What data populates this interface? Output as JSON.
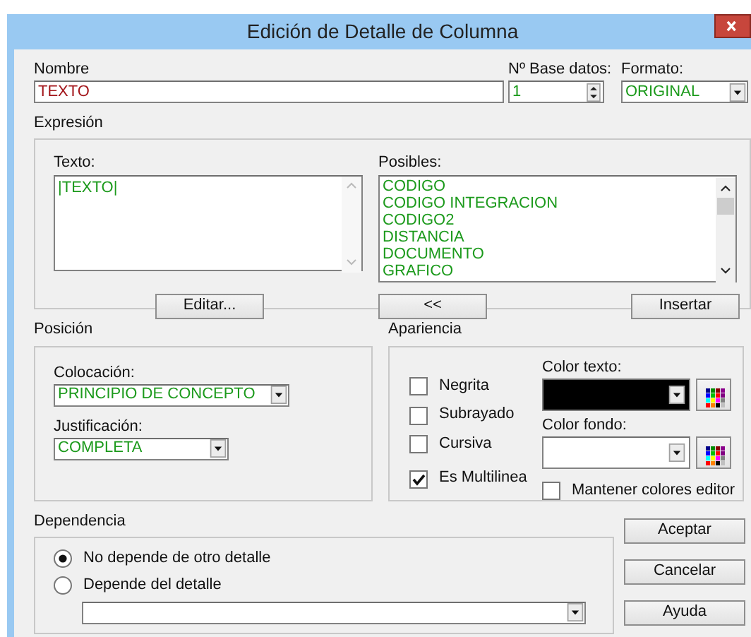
{
  "window": {
    "title": "Edición de Detalle de Columna"
  },
  "nombre": {
    "label": "Nombre",
    "value": "TEXTO"
  },
  "base_datos": {
    "label": "Nº Base datos:",
    "value": "1"
  },
  "formato": {
    "label": "Formato:",
    "value": "ORIGINAL"
  },
  "expresion": {
    "title": "Expresión",
    "texto": {
      "label": "Texto:",
      "value": "|TEXTO|"
    },
    "posibles": {
      "label": "Posibles:",
      "items": [
        "CODIGO",
        "CODIGO INTEGRACION",
        "CODIGO2",
        "DISTANCIA",
        "DOCUMENTO",
        "GRAFICO"
      ]
    },
    "buttons": [
      "Editar...",
      "<<",
      "Insertar"
    ]
  },
  "posicion": {
    "title": "Posición",
    "colocacion": {
      "label": "Colocación:",
      "value": "PRINCIPIO DE CONCEPTO"
    },
    "justificacion": {
      "label": "Justificación:",
      "value": "COMPLETA"
    }
  },
  "apariencia": {
    "title": "Apariencia",
    "checkboxes": [
      {
        "label": "Negrita",
        "checked": false
      },
      {
        "label": "Subrayado",
        "checked": false
      },
      {
        "label": "Cursiva",
        "checked": false
      },
      {
        "label": "Es Multilinea",
        "checked": true
      }
    ],
    "color_texto": {
      "label": "Color texto:",
      "color": "#000000"
    },
    "color_fondo": {
      "label": "Color fondo:",
      "color": "#ffffff"
    },
    "mantener": {
      "label": "Mantener colores editor",
      "checked": false
    }
  },
  "dependencia": {
    "title": "Dependencia",
    "options": [
      {
        "label": "No depende de otro detalle",
        "selected": true
      },
      {
        "label": "Depende del detalle",
        "selected": false
      }
    ]
  },
  "buttons": [
    "Aceptar",
    "Cancelar",
    "Ayuda"
  ]
}
